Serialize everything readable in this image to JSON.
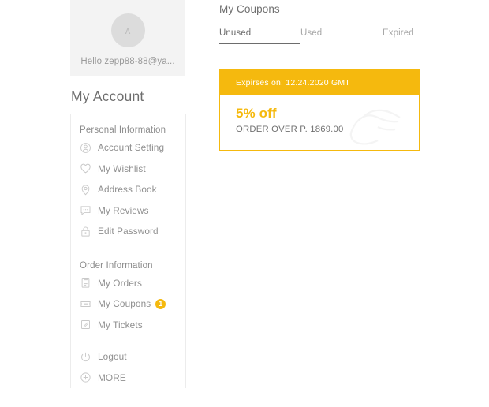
{
  "profile": {
    "avatar_glyph": "ʌ",
    "avatar_icon": "avatar-placeholder-icon",
    "greeting": "Hello zepp88-88@ya..."
  },
  "sidebar": {
    "title": "My Account",
    "sections": [
      {
        "label": "Personal Information",
        "items": [
          {
            "label": "Account Setting",
            "icon": "user-circle-icon",
            "badge": null
          },
          {
            "label": "My Wishlist",
            "icon": "heart-icon",
            "badge": null
          },
          {
            "label": "Address Book",
            "icon": "location-pin-icon",
            "badge": null
          },
          {
            "label": "My Reviews",
            "icon": "speech-bubble-icon",
            "badge": null
          },
          {
            "label": "Edit Password",
            "icon": "lock-icon",
            "badge": null
          }
        ]
      },
      {
        "label": "Order Information",
        "items": [
          {
            "label": "My Orders",
            "icon": "clipboard-icon",
            "badge": null
          },
          {
            "label": "My Coupons",
            "icon": "ticket-icon",
            "badge": "1"
          },
          {
            "label": "My Tickets",
            "icon": "note-pencil-icon",
            "badge": null
          }
        ]
      }
    ],
    "footer_items": [
      {
        "label": "Logout",
        "icon": "power-icon"
      },
      {
        "label": "MORE",
        "icon": "plus-circle-icon"
      }
    ]
  },
  "main": {
    "title": "My Coupons",
    "tabs": [
      {
        "label": "Unused",
        "active": true
      },
      {
        "label": "Used",
        "active": false
      },
      {
        "label": "Expired",
        "active": false
      }
    ],
    "coupons": [
      {
        "expiry": "Expirses on: 12.24.2020 GMT",
        "discount": "5% off",
        "condition": "ORDER OVER P. 1869.00"
      }
    ]
  },
  "colors": {
    "accent": "#f5b90e",
    "text_muted": "#8f8f8f",
    "panel_border": "#ececec",
    "profile_bg": "#f3f3f3"
  }
}
